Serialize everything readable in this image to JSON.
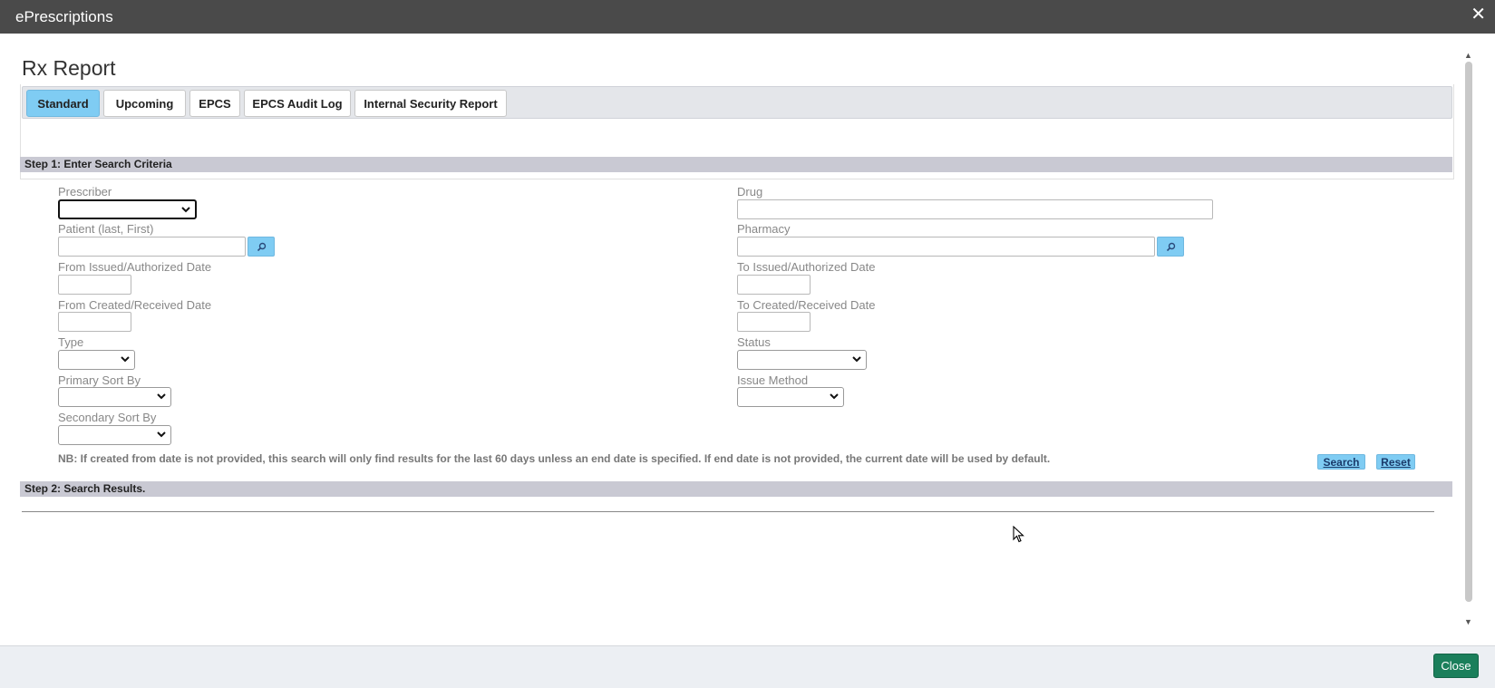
{
  "window": {
    "title": "ePrescriptions",
    "close_icon": "close-icon"
  },
  "page": {
    "title": "Rx Report"
  },
  "tabs": [
    {
      "label": "Standard",
      "active": true
    },
    {
      "label": "Upcoming",
      "active": false
    },
    {
      "label": "EPCS",
      "active": false
    },
    {
      "label": "EPCS Audit Log",
      "active": false
    },
    {
      "label": "Internal Security Report",
      "active": false
    }
  ],
  "step1": {
    "title": "Step 1: Enter Search Criteria",
    "fields": {
      "prescriber": {
        "label": "Prescriber",
        "value": ""
      },
      "drug": {
        "label": "Drug",
        "value": ""
      },
      "patient": {
        "label": "Patient (last, First)",
        "value": ""
      },
      "pharmacy": {
        "label": "Pharmacy",
        "value": ""
      },
      "from_issued": {
        "label": "From Issued/Authorized Date",
        "value": ""
      },
      "to_issued": {
        "label": "To Issued/Authorized Date",
        "value": ""
      },
      "from_created": {
        "label": "From Created/Received Date",
        "value": ""
      },
      "to_created": {
        "label": "To Created/Received Date",
        "value": ""
      },
      "type": {
        "label": "Type",
        "value": ""
      },
      "status": {
        "label": "Status",
        "value": ""
      },
      "primary_sort": {
        "label": "Primary Sort By",
        "value": ""
      },
      "issue_method": {
        "label": "Issue Method",
        "value": ""
      },
      "secondary_sort": {
        "label": "Secondary Sort By",
        "value": ""
      }
    },
    "note": "NB: If created from date is not provided, this search will only find results for the last 60 days unless an end date is specified. If end date is not provided, the current date will be used by default.",
    "search_label": "Search",
    "reset_label": "Reset"
  },
  "step2": {
    "title": "Step 2:  Search Results."
  },
  "footer": {
    "close_label": "Close"
  },
  "colors": {
    "accent": "#7fccf3",
    "titlebar": "#4a4a4a",
    "close_button": "#1b7f5b"
  }
}
